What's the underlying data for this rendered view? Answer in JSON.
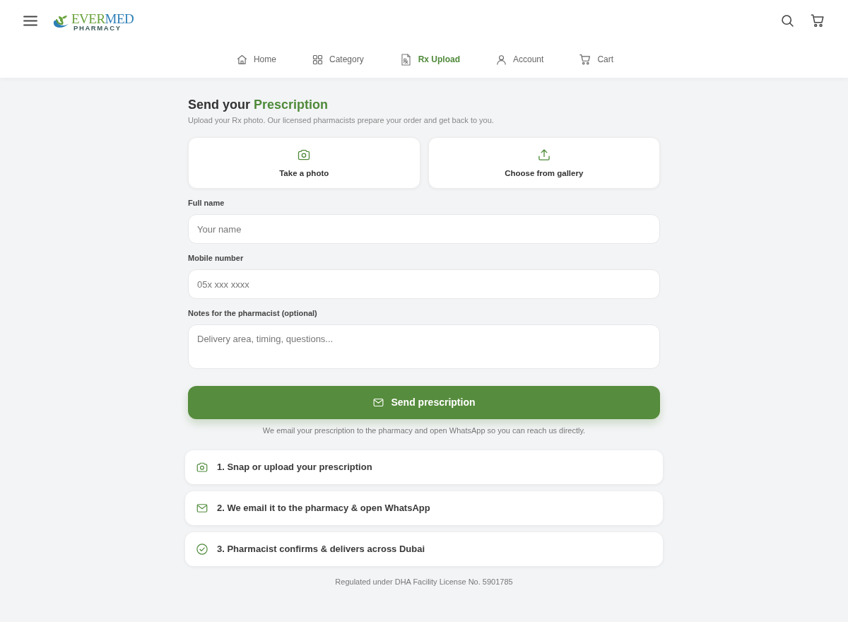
{
  "header": {
    "logo": {
      "name_parts": [
        "EVER",
        "MED"
      ],
      "tagline": "PHARMACY"
    }
  },
  "nav": [
    {
      "kind": "home",
      "label": "Home",
      "selected": false
    },
    {
      "kind": "category",
      "label": "Category",
      "selected": false
    },
    {
      "kind": "rx",
      "label": "Rx Upload",
      "selected": true
    },
    {
      "kind": "account",
      "label": "Account",
      "selected": false
    },
    {
      "kind": "cart",
      "label": "Cart",
      "selected": false
    }
  ],
  "page": {
    "title": {
      "text": "Send your",
      "highlight": "Prescription"
    },
    "subtitle": "Upload your Rx photo. Our licensed pharmacists prepare your order and get back to you."
  },
  "upload_options": [
    {
      "kind": "camera",
      "label": "Take a photo"
    },
    {
      "kind": "upload",
      "label": "Choose from gallery"
    }
  ],
  "form": {
    "fields": [
      {
        "kind": "input",
        "label": "Full name",
        "placeholder": "Your name"
      },
      {
        "kind": "input",
        "label": "Mobile number",
        "placeholder": "05x xxx xxxx"
      },
      {
        "kind": "textarea",
        "label": "Notes for the pharmacist (optional)",
        "placeholder": "Delivery area, timing, questions..."
      }
    ],
    "submit": "Send prescription",
    "note": "We email your prescription to the pharmacy and open WhatsApp so you can reach us directly."
  },
  "steps": [
    {
      "kind": "camera",
      "text": "1. Snap or upload your prescription"
    },
    {
      "kind": "email",
      "text": "2. We email it to the pharmacy & open WhatsApp"
    },
    {
      "kind": "check",
      "text": "3. Pharmacist confirms & delivers across Dubai"
    }
  ],
  "footer": "Regulated under DHA Facility License No. 5901785"
}
